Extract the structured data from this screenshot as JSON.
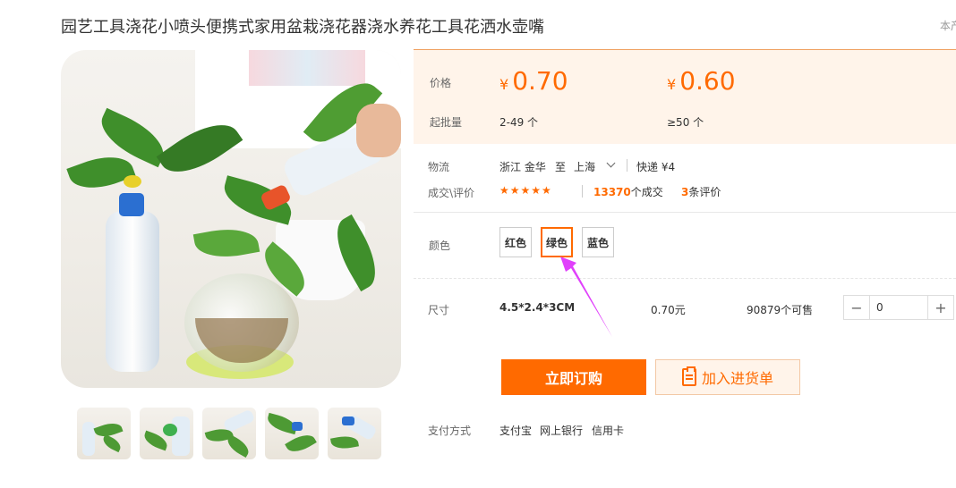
{
  "product": {
    "title": "园艺工具浇花小喷头便携式家用盆栽浇花器浇水养花工具花洒水壶嘴",
    "corner_text": "本产"
  },
  "price": {
    "label": "价格",
    "currency": "¥",
    "tiers": [
      {
        "price": "0.70",
        "min_qty_label": "2-49 个"
      },
      {
        "price": "0.60",
        "min_qty_label": "≥50 个"
      }
    ],
    "min_qty_label": "起批量"
  },
  "logistics": {
    "label": "物流",
    "from": "浙江 金华",
    "to_word": "至",
    "to": "上海",
    "shipping": "快递 ¥4"
  },
  "reviews": {
    "label": "成交\\评价",
    "stars": "★★★★★",
    "deals_count": "13370",
    "deals_suffix": "个成交",
    "review_count": "3",
    "review_suffix": "条评价",
    "rating": 5
  },
  "color": {
    "label": "颜色",
    "options": [
      "红色",
      "绿色",
      "蓝色"
    ],
    "selected": "绿色"
  },
  "size": {
    "label": "尺寸",
    "value": "4.5*2.4*3CM",
    "price": "0.70元",
    "stock": "90879个可售",
    "quantity": "0",
    "minus": "−",
    "plus": "+"
  },
  "actions": {
    "buy_now": "立即订购",
    "add_to_list": "加入进货单"
  },
  "payment": {
    "label": "支付方式",
    "methods": [
      "支付宝",
      "网上银行",
      "信用卡"
    ]
  },
  "colors": {
    "accent": "#ff6a00",
    "price_bg": "#fff4ea",
    "annotation_arrow": "#e040fb"
  }
}
